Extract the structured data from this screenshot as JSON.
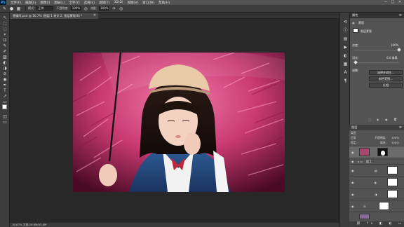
{
  "menubar": {
    "logo": "Ps",
    "items": [
      "文件(F)",
      "编辑(E)",
      "图像(I)",
      "图层(L)",
      "文字(Y)",
      "选择(S)",
      "滤镜(T)",
      "3D(D)",
      "视图(V)",
      "窗口(W)",
      "帮助(H)"
    ],
    "controls": [
      "—",
      "□",
      "✕"
    ]
  },
  "options": {
    "mode_label": "模式:",
    "mode_value": "正常",
    "opacity_label": "不透明度:",
    "opacity_value": "100%",
    "flow_label": "流量:",
    "flow_value": "100%"
  },
  "document_tab": {
    "title": "感情阿.psd @ 16.7% (图层 1 拷贝 2, 图层蒙版/8) *",
    "close": "×"
  },
  "status": {
    "text": "16.67%   文档:29.6M/93.6M"
  },
  "tools": [
    "↖",
    "⬚",
    "◌",
    "⌖",
    "⊡",
    "✎",
    "✐",
    "▨",
    "◐",
    "◑",
    "⊘",
    "◉",
    "✒",
    "T",
    "↗",
    "▭",
    "✋",
    "🔍"
  ],
  "properties": {
    "tab": "属性",
    "mask_label": "图层蒙版",
    "density_label": "浓度:",
    "density_value": "100%",
    "feather_label": "羽化:",
    "feather_value": "0.0 像素",
    "adjust_label": "调整:",
    "btn_select_mask": "选择并遮住...",
    "btn_color_range": "颜色范围...",
    "btn_invert": "反相"
  },
  "layers": {
    "tab": "图层",
    "kind_label": "类型",
    "blend_mode": "正常",
    "opacity_label": "不透明度:",
    "opacity_value": "100%",
    "lock_label": "锁定:",
    "fill_label": "填充:",
    "fill_value": "100%",
    "group_name": "组 1",
    "rows": [
      {
        "name": "",
        "thumb": "photo"
      },
      {
        "name": "组 1",
        "thumb": "folder"
      },
      {
        "name": "",
        "thumb": "white"
      },
      {
        "name": "",
        "thumb": "white"
      },
      {
        "name": "",
        "thumb": "white"
      },
      {
        "name": "",
        "thumb": "white"
      }
    ]
  }
}
